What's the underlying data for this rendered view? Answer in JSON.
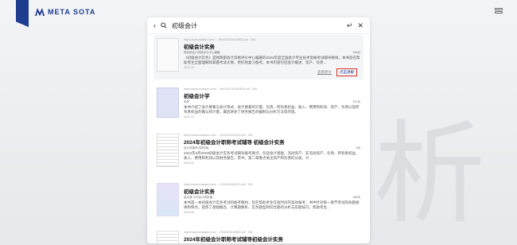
{
  "brand": {
    "name": "META SOTA"
  },
  "background": {
    "glyph": "析"
  },
  "search": {
    "query": "初级会计"
  },
  "icons": {
    "back": "chevron-left-icon",
    "search": "search-icon",
    "enter": "enter-icon",
    "close": "close-icon",
    "menu": "menu-icon"
  },
  "results": [
    {
      "url": "https://www.sfpatch.com/...../file/2023/0401/6823.pdf   · 306",
      "title": "初级会计实务",
      "publisher": "财政部会计资格评价中心编著",
      "pages": "596页",
      "desc": "《初级会计实务》是财政部会计资格评价中心编著的2022年度全国会计专业技术资格考试辅导教材。本书旨在帮助考生全面理解和掌握考试大纲，更好地复习备考。本书内容包括会计概述、资产、负债...",
      "date": "2022-10",
      "link": "查看原文",
      "action": "点击讲解"
    },
    {
      "url": "https://www.example.com/...../file/2021/1215/0876.pdf   · 306",
      "title": "初级会计学",
      "publisher": "朱婷",
      "pages": "521页",
      "desc": "本书介绍了会计要素与会计等式、会计要素的计量、负债、所有者权益、收入、费用和利润、资产、负债以及所有者权益的确认和计量，最后讲述了财务报告的编制与分析方法等内容。",
      "date": "2021-12",
      "link": "",
      "action": ""
    },
    {
      "url": "https://www.example.com/...../2024/0220/3312.pdf   · 306",
      "title": "2024年初级会计职称考试辅导 初级会计实务",
      "publisher": "会计资格考试研究组",
      "pages": "5页",
      "desc": "2024年5月2023初级会计实务考试辅导备考要点，包括会计基础、流动资产、非流动资产、负债、所有者权益、收入、费用和利润以及财务报告，其中，第二章重点关注资产和负债的分类，计...",
      "date": "2024-02",
      "link": "",
      "action": ""
    },
    {
      "url": "https://www.example.com/...../2019/0618/4471.pdf   · 306",
      "title": "初级会计实务",
      "publisher": "高志谦 中华会计网校编",
      "pages": "485页",
      "desc": "本书是一本初级会计实务考试的备考教材，旨在帮助考生在短时间内高效备考，书中针对每一章节考试的命题规律和特点，提炼了基础概念、计算题解析、实务题型和综合题的分析与答题技巧，帮助考生...",
      "date": "2019-05",
      "link": "",
      "action": ""
    },
    {
      "url": "https://www.example.com/...../2024/0301/5520.pdf   · 306",
      "title": "2024年初级会计职称考试辅导初级会计实务",
      "publisher": "",
      "pages": "",
      "desc": "",
      "date": "",
      "link": "",
      "action": ""
    }
  ]
}
